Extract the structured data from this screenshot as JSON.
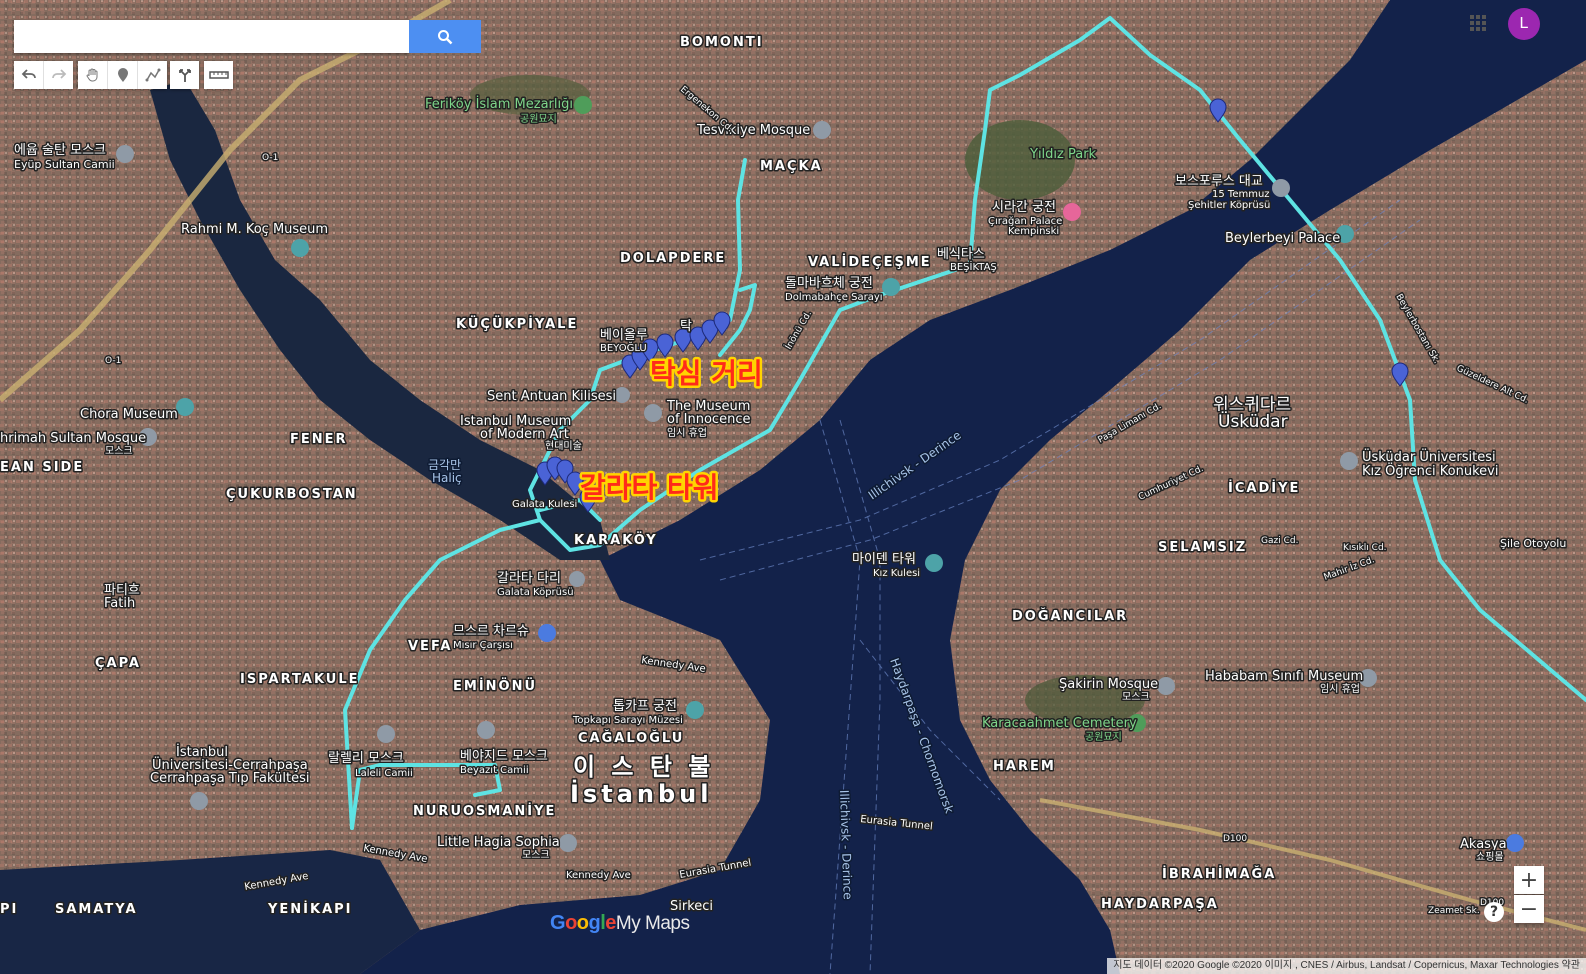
{
  "search": {
    "placeholder": "",
    "value": ""
  },
  "toolbar": {
    "undo_icon": "undo-icon",
    "redo_icon": "redo-icon",
    "pan_icon": "hand-icon",
    "marker_icon": "marker-icon",
    "line_icon": "draw-line-icon",
    "directions_icon": "directions-icon",
    "measure_icon": "ruler-icon"
  },
  "account": {
    "avatar_letter": "L",
    "avatar_color": "#9c27b0"
  },
  "zoom": {
    "in_label": "+",
    "out_label": "−"
  },
  "help": {
    "label": "?"
  },
  "brand": {
    "google": [
      "G",
      "o",
      "o",
      "g",
      "l",
      "e"
    ],
    "product": "My Maps"
  },
  "attribution": "지도 데이터 ©2020 Google ©2020 이미지 , CNES / Airbus, Landsat / Copernicus, Maxar Technologies   약관",
  "route": {
    "color": "#5ee3e3"
  },
  "annotations": {
    "taksim": "탁심 거리",
    "galata": "갈라타 타워"
  },
  "districts": {
    "bomonti": "BOMONTI",
    "macka": "MAÇKA",
    "dolapdere": "DOLAPDERE",
    "valideceşme": "VALİDEÇEŞME",
    "kucukpiyale": "KÜÇÜKPİYALE",
    "fener": "FENER",
    "cukurbostan": "ÇUKURBOSTAN",
    "ean_side": "EAN SIDE",
    "capa": "ÇAPA",
    "ispartakule": "ISPARTAKULE",
    "vefa": "VEFA",
    "eminonu": "EMİNÖNÜ",
    "karakoy": "KARAKÖY",
    "cagaloglu": "CAĞALOĞLU",
    "nuruosmaniye": "NURUOSMANİYE",
    "samatya": "SAMATYA",
    "yenikapi": "YENİKAPI",
    "icadiye": "İCADİYE",
    "selamsiz": "SELAMSIZ",
    "dogancilar": "DOĞANCILAR",
    "harem": "HAREM",
    "ibrahimaga": "İBRAHİMAĞA",
    "haydarpasa": "HAYDARPAŞA",
    "sirkeci": "Sirkeci",
    "pi": "PI",
    "istanbul_ko": "이 스 탄 불",
    "istanbul": "İstanbul",
    "uskudar_ko": "위스퀴다르",
    "uskudar": "Üsküdar"
  },
  "places": {
    "ferikoy": "Feriköy İslam Mezarlığı",
    "ferikoy_sub": "공원묘지",
    "tesvikiye": "Tesvikiye Mosque",
    "eyup_ko": "에윱 술탄 모스크",
    "eyup": "Eyüp Sultan Camii",
    "rahmi": "Rahmi M. Koç Museum",
    "yildiz": "Yıldız Park",
    "ciragan_ko": "시라간 궁전",
    "ciragan": "Çırağan Palace",
    "ciragan_sub": "Kempinski",
    "bosphorus_ko": "보스포루스 대교",
    "bosphorus": "15 Temmuz",
    "bosphorus_sub": "Şehitler Köprüsü",
    "beylerbeyi": "Beylerbeyi Palace",
    "dolmabahce_ko": "돌마바흐체 궁전",
    "dolmabahce": "Dolmabahçe Sarayı",
    "besiktas_ko": "베식타스",
    "besiktas": "BEŞİKTAŞ",
    "beyoglu_ko": "베이올루",
    "beyoglu": "BEYOĞLU",
    "taksim_short": "탁",
    "sent_antuan": "Sent Antuan Kilisesi",
    "istanbul_museum": "Istanbul Museum",
    "modern_art": "of Modern Art",
    "modern_art_ko": "현대미술",
    "innocence_1": "The Museum",
    "innocence_2": "of Innocence",
    "innocence_ko": "임시 휴업",
    "chora": "Chora Museum",
    "mihrimah": "hrimah Sultan Mosque",
    "mihrimah_sub": "모스크",
    "halic_ko": "금각만",
    "halic": "Haliç",
    "galata_kulesi": "Galata Kulesi",
    "galata_bridge_ko": "갈라타 다리",
    "galata_bridge": "Galata Köprüsü",
    "fatih_ko": "파티흐",
    "fatih": "Fatih",
    "spice_ko": "므스르 차르슈",
    "spice": "Mısır Çarşısı",
    "topkapi_ko": "톱카프 궁전",
    "topkapi": "Topkapı Sarayı Müzesi",
    "beyazit_ko": "베야지드 모스크",
    "beyazit": "Beyazıt Camii",
    "laleli": "Laleli Camii",
    "laleli_ko": "랄렐리 모스크",
    "cerrahpasa_1": "İstanbul",
    "cerrahpasa_2": "Üniversitesi-Cerrahpaşa",
    "cerrahpasa_3": "Cerrahpaşa Tıp Fakültesi",
    "little_hagia": "Little Hagia Sophia",
    "little_hagia_sub": "모스크",
    "maiden_ko": "마이덴 타워",
    "maiden": "Kız Kulesi",
    "uskudar_uni_1": "Üsküdar Üniversitesi",
    "uskudar_uni_2": "Kız Öğrenci Konukevi",
    "sakirin": "Şakirin Mosque",
    "sakirin_sub": "모스크",
    "hababam": "Hababam Sınıfı Museum",
    "hababam_sub": "임시 휴업",
    "karacaahmet": "Karacaahmet Cemetery",
    "karacaahmet_sub": "공원묘지",
    "akasya": "Akasya",
    "akasya_sub": "쇼핑몰"
  },
  "roads": {
    "kennedy1": "Kennedy Ave",
    "kennedy2": "Kennedy Ave",
    "kennedy3": "Kennedy Ave",
    "kennedy4": "Kennedy Ave",
    "eurasia_tunnel": "Eurasia Tunnel",
    "eurasia_tunnel2": "Eurasia Tunnel",
    "o1a": "O-1",
    "o1b": "O-1",
    "d100a": "D100",
    "d100b": "D100",
    "sile": "Şile Otoyolu",
    "ergenekon": "Ergenekon Cd.",
    "inonu": "İnönü Cd.",
    "gazi": "Gazi Cd.",
    "kisikli": "Kısıklı Cd.",
    "mahir": "Mahir İz Cd.",
    "zeamet": "Zeamet Sk.",
    "cumhuriyet": "Cumhuriyet Cd.",
    "pasa_limani": "Paşa Limanı Cd.",
    "guzeldere": "Güzeldere Alt Cd.",
    "beylerbostani": "Beylerbostanı Sk."
  },
  "waters": {
    "ship_lane_1": "Illichivsk - Derince",
    "ship_lane_2": "Haydarpaşa - Chornomorsk",
    "ship_lane_3": "Illichivsk - Derince"
  },
  "markers": {
    "color": "#4a63d6",
    "groups": [
      "taksim-street",
      "galata-tower",
      "bosphorus-shore",
      "uskudar-highway"
    ]
  }
}
